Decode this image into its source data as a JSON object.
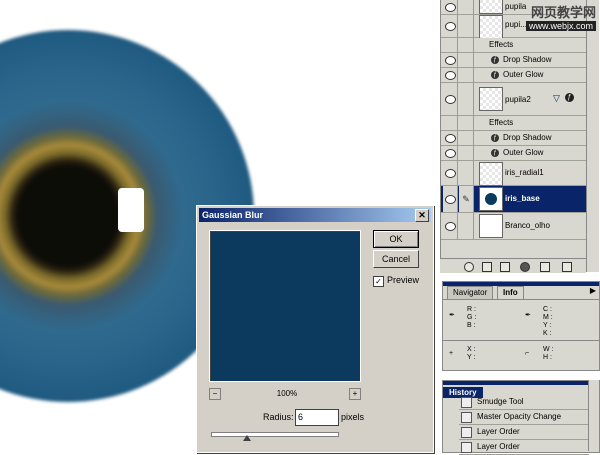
{
  "watermark": {
    "site": "网页教学网",
    "url": "www.webjx.com"
  },
  "layers": {
    "rows": [
      {
        "label": "pupila",
        "kind": "layer"
      },
      {
        "label": "pupi...",
        "kind": "layer"
      },
      {
        "label": "Effects",
        "kind": "effects"
      },
      {
        "label": "Drop Shadow",
        "kind": "effect"
      },
      {
        "label": "Outer Glow",
        "kind": "effect"
      },
      {
        "label": "pupila2",
        "kind": "layer"
      },
      {
        "label": "Effects",
        "kind": "effects"
      },
      {
        "label": "Drop Shadow",
        "kind": "effect"
      },
      {
        "label": "Outer Glow",
        "kind": "effect"
      },
      {
        "label": "iris_radial1",
        "kind": "layer"
      },
      {
        "label": "iris_base",
        "kind": "layer",
        "selected": true
      },
      {
        "label": "Branco_olho",
        "kind": "layer"
      }
    ]
  },
  "navinfo": {
    "tabs": [
      "Navigator",
      "Info"
    ],
    "labels_left1": [
      "R :",
      "G :",
      "B :"
    ],
    "labels_right1": [
      "C :",
      "M :",
      "Y :",
      "K :"
    ],
    "labels_left2": [
      "X :",
      "Y :"
    ],
    "labels_right2": [
      "W :",
      "H :"
    ]
  },
  "history": {
    "title": "History",
    "items": [
      "Smudge Tool",
      "Master Opacity Change",
      "Layer Order",
      "Layer Order"
    ]
  },
  "dialog": {
    "title": "Gaussian Blur",
    "ok": "OK",
    "cancel": "Cancel",
    "preview_label": "Preview",
    "preview_checked": "✓",
    "zoom": "100%",
    "radius_label": "Radius:",
    "radius_value": "6",
    "unit": "pixels",
    "preview_color": "#0b3a5e"
  }
}
